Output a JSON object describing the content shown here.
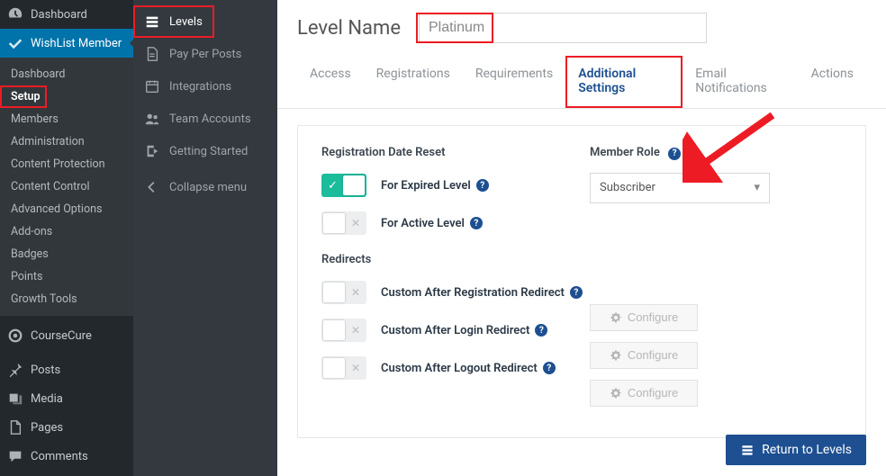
{
  "wp_sidebar": {
    "items_top": [
      {
        "label": "Dashboard",
        "icon": "gauge-icon"
      },
      {
        "label": "WishList Member",
        "icon": "check-icon",
        "active": true
      }
    ],
    "submenu": [
      {
        "label": "Dashboard"
      },
      {
        "label": "Setup",
        "selected": true
      },
      {
        "label": "Members"
      },
      {
        "label": "Administration"
      },
      {
        "label": "Content Protection"
      },
      {
        "label": "Content Control"
      },
      {
        "label": "Advanced Options"
      },
      {
        "label": "Add-ons"
      },
      {
        "label": "Badges"
      },
      {
        "label": "Points"
      },
      {
        "label": "Growth Tools"
      }
    ],
    "items_bottom": [
      {
        "label": "CourseCure",
        "icon": "record-icon"
      },
      {
        "label": "Posts",
        "icon": "pin-icon"
      },
      {
        "label": "Media",
        "icon": "media-icon"
      },
      {
        "label": "Pages",
        "icon": "page-icon"
      },
      {
        "label": "Comments",
        "icon": "comment-icon"
      }
    ]
  },
  "wlm_sidebar": {
    "items": [
      {
        "label": "Levels",
        "icon": "list-icon",
        "active": true
      },
      {
        "label": "Pay Per Posts",
        "icon": "doc-icon"
      },
      {
        "label": "Integrations",
        "icon": "calendar-icon"
      },
      {
        "label": "Team Accounts",
        "icon": "people-icon"
      },
      {
        "label": "Getting Started",
        "icon": "exit-icon"
      },
      {
        "label": "Collapse menu",
        "icon": "chevron-left-icon"
      }
    ]
  },
  "level_name": {
    "label": "Level Name",
    "value": "Platinum"
  },
  "tabs": [
    {
      "label": "Access"
    },
    {
      "label": "Registrations"
    },
    {
      "label": "Requirements"
    },
    {
      "label": "Additional Settings",
      "active": true
    },
    {
      "label": "Email Notifications"
    },
    {
      "label": "Actions"
    }
  ],
  "reg_reset": {
    "title": "Registration Date Reset",
    "rows": [
      {
        "label": "For Expired Level",
        "on": true
      },
      {
        "label": "For Active Level",
        "on": false
      }
    ]
  },
  "member_role": {
    "title": "Member Role",
    "value": "Subscriber"
  },
  "redirects": {
    "title": "Redirects",
    "rows": [
      {
        "label": "Custom After Registration Redirect",
        "btn": "Configure"
      },
      {
        "label": "Custom After Login Redirect",
        "btn": "Configure"
      },
      {
        "label": "Custom After Logout Redirect",
        "btn": "Configure"
      }
    ]
  },
  "return_btn": "Return to Levels"
}
